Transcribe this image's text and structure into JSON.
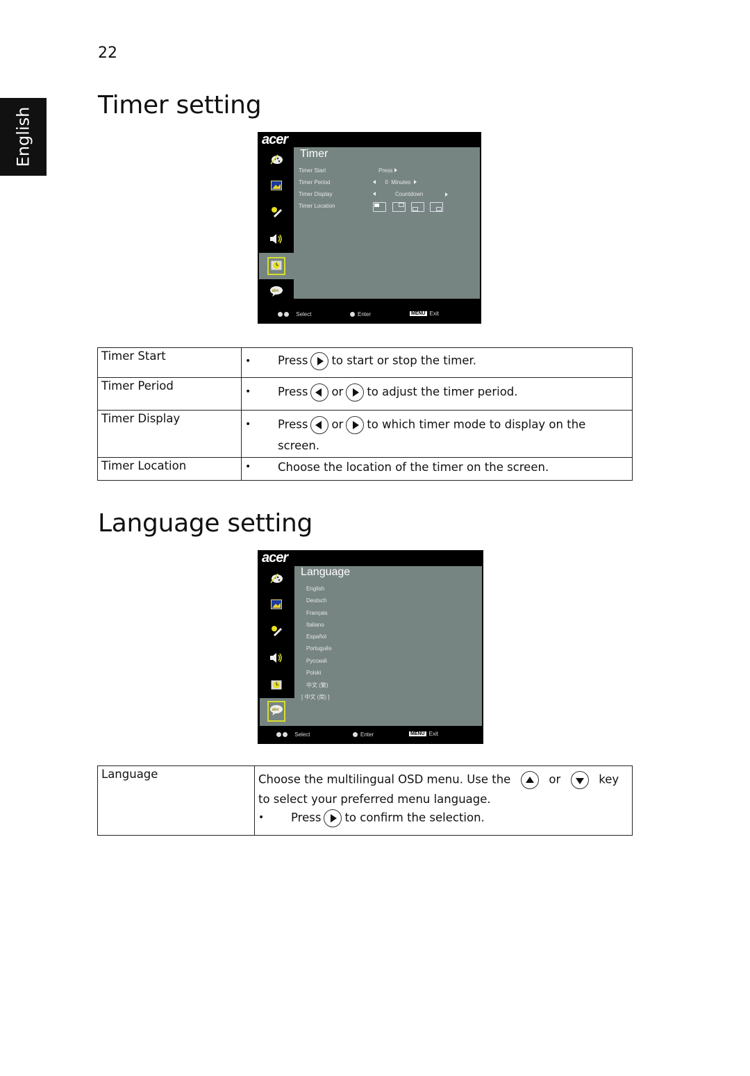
{
  "page": {
    "number": "22",
    "side_tab": "English"
  },
  "timer_section": {
    "heading": "Timer setting",
    "osd": {
      "logo": "acer",
      "title": "Timer",
      "rows": [
        {
          "label": "Timer Start",
          "value": "Press"
        },
        {
          "label": "Timer Period",
          "value": "0",
          "unit": "Minutes"
        },
        {
          "label": "Timer Display",
          "value": "Countdown"
        },
        {
          "label": "Timer Location",
          "options": [
            "top-left",
            "top-right",
            "bottom-left",
            "bottom-right"
          ],
          "selected": "top-left"
        }
      ],
      "footer": {
        "select": "Select",
        "enter": "Enter",
        "menu_badge": "MENU",
        "exit": "Exit"
      },
      "side_icons": [
        "palette-icon",
        "picture-icon",
        "settings-icon",
        "audio-icon",
        "timer-icon",
        "language-icon"
      ],
      "selected_side_icon": "timer-icon"
    },
    "table": [
      {
        "label": "Timer Start",
        "press": "Press",
        "text": "to start or stop the timer."
      },
      {
        "label": "Timer Period",
        "press": "Press",
        "or": "or",
        "text": "to adjust the timer period."
      },
      {
        "label": "Timer Display",
        "press": "Press",
        "or": "or",
        "text": "to which timer mode to display on the",
        "text2": "screen."
      },
      {
        "label": "Timer Location",
        "text": "Choose the location of the timer on the screen."
      }
    ]
  },
  "language_section": {
    "heading": "Language setting",
    "osd": {
      "logo": "acer",
      "title": "Language",
      "languages": [
        "English",
        "Deutsch",
        "Français",
        "Italiano",
        "Español",
        "Português",
        "Русский",
        "Polski",
        "中文 (繁)",
        "[ 中文 (简) ]"
      ],
      "footer": {
        "select": "Select",
        "enter": "Enter",
        "menu_badge": "MENU",
        "exit": "Exit"
      },
      "side_icons": [
        "palette-icon",
        "picture-icon",
        "settings-icon",
        "audio-icon",
        "timer-icon",
        "language-icon"
      ],
      "selected_side_icon": "language-icon"
    },
    "table": {
      "label": "Language",
      "line1_a": "Choose the multilingual OSD menu. Use the",
      "line1_or": "or",
      "line1_b": "key",
      "line2": "to select your preferred menu language.",
      "press": "Press",
      "line3": "to confirm the selection."
    }
  },
  "colors": {
    "osd_panel": "#778582",
    "osd_bg": "#000000",
    "highlight": "#d8dc2a"
  }
}
